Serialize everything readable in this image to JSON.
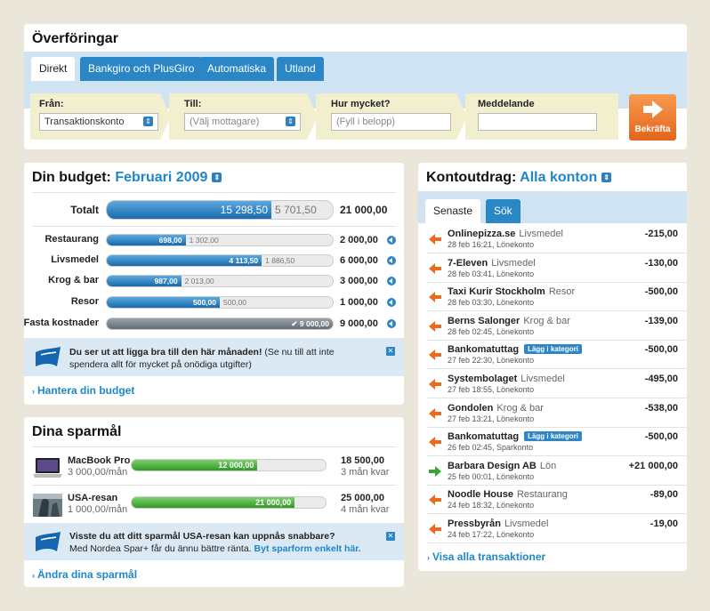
{
  "transfers": {
    "title": "Överföringar",
    "tabs": [
      "Direkt",
      "Bankgiro och PlusGiro",
      "Automatiska",
      "Utland"
    ],
    "from": {
      "label": "Från:",
      "value": "Transaktionskonto"
    },
    "to": {
      "label": "Till:",
      "placeholder": "(Välj mottagare)"
    },
    "amount": {
      "label": "Hur mycket?",
      "placeholder": "(Fyll i belopp)"
    },
    "message": {
      "label": "Meddelande",
      "value": ""
    },
    "confirm_label": "Bekräfta",
    "colors": {
      "confirm": "#e9742a",
      "tab": "#2b86c5",
      "field_bg": "#f2efcf"
    }
  },
  "budget": {
    "title": "Din budget:",
    "period": "Februari 2009",
    "total": {
      "label": "Totalt",
      "spent": "15 298,50",
      "remaining": "5 701,50",
      "amount": "21 000,00",
      "fraction": 0.7285
    },
    "rows": [
      {
        "name": "Restaurang",
        "spent": "698,00",
        "remaining": "1 302,00",
        "amount": "2 000,00",
        "fraction": 0.349
      },
      {
        "name": "Livsmedel",
        "spent": "4 113,50",
        "remaining": "1 886,50",
        "amount": "6 000,00",
        "fraction": 0.6856
      },
      {
        "name": "Krog & bar",
        "spent": "987,00",
        "remaining": "2 013,00",
        "amount": "3 000,00",
        "fraction": 0.329
      },
      {
        "name": "Resor",
        "spent": "500,00",
        "remaining": "500,00",
        "amount": "1 000,00",
        "fraction": 0.5
      },
      {
        "name": "Fasta kostnader",
        "spent": "9 000,00",
        "remaining": "",
        "amount": "9 000,00",
        "fraction": 1.0
      }
    ],
    "tip_bold": "Du ser ut att ligga bra till den här månaden!",
    "tip_text": " (Se nu till att inte spendera allt för mycket på onödiga utgifter)",
    "link": "Hantera din budget"
  },
  "savings": {
    "title": "Dina sparmål",
    "goals": [
      {
        "name": "MacBook Pro",
        "per_month": "3 000,00/mån",
        "saved": "12 000,00",
        "target": "18 500,00",
        "left": "3 mån kvar",
        "fraction": 0.6486
      },
      {
        "name": "USA-resan",
        "per_month": "1 000,00/mån",
        "saved": "21 000,00",
        "target": "25 000,00",
        "left": "4 mån kvar",
        "fraction": 0.84
      }
    ],
    "tip_bold": "Visste du att ditt sparmål USA-resan kan uppnås snabbare?",
    "tip_text": "Med Nordea Spar+ får du ännu bättre ränta. ",
    "tip_link": "Byt sparform enkelt här.",
    "link": "Ändra dina sparmål"
  },
  "statement": {
    "title": "Kontoutdrag:",
    "account": "Alla konton",
    "tabs": [
      "Senaste",
      "Sök"
    ],
    "transactions": [
      {
        "name": "Onlinepizza.se",
        "category": "Livsmedel",
        "badge": "",
        "date": "28 feb 16:21, Lönekonto",
        "amount": "-215,00",
        "direction": "out"
      },
      {
        "name": "7-Eleven",
        "category": "Livsmedel",
        "badge": "",
        "date": "28 feb 03:41, Lönekonto",
        "amount": "-130,00",
        "direction": "out"
      },
      {
        "name": "Taxi Kurir Stockholm",
        "category": "Resor",
        "badge": "",
        "date": "28 feb 03:30, Lönekonto",
        "amount": "-500,00",
        "direction": "out"
      },
      {
        "name": "Berns Salonger",
        "category": "Krog & bar",
        "badge": "",
        "date": "28 feb 02:45, Lönekonto",
        "amount": "-139,00",
        "direction": "out"
      },
      {
        "name": "Bankomatuttag",
        "category": "",
        "badge": "Lägg i kategori",
        "date": "27 feb 22:30, Lönekonto",
        "amount": "-500,00",
        "direction": "out"
      },
      {
        "name": "Systembolaget",
        "category": "Livsmedel",
        "badge": "",
        "date": "27 feb 18:55, Lönekonto",
        "amount": "-495,00",
        "direction": "out"
      },
      {
        "name": "Gondolen",
        "category": "Krog & bar",
        "badge": "",
        "date": "27 feb 13:21, Lönekonto",
        "amount": "-538,00",
        "direction": "out"
      },
      {
        "name": "Bankomatuttag",
        "category": "",
        "badge": "Lägg i kategori",
        "date": "26 feb 02:45, Sparkonto",
        "amount": "-500,00",
        "direction": "out"
      },
      {
        "name": "Barbara Design AB",
        "category": "Lön",
        "badge": "",
        "date": "25 feb 00:01, Lönekonto",
        "amount": "+21 000,00",
        "direction": "in"
      },
      {
        "name": "Noodle House",
        "category": "Restaurang",
        "badge": "",
        "date": "24 feb 18:32, Lönekonto",
        "amount": "-89,00",
        "direction": "out"
      },
      {
        "name": "Pressbyrån",
        "category": "Livsmedel",
        "badge": "",
        "date": "24 feb 17:22, Lönekonto",
        "amount": "-19,00",
        "direction": "out"
      }
    ],
    "link": "Visa alla transaktioner",
    "colors": {
      "out_arrow": "#ec6a1f",
      "in_arrow": "#3aa335"
    }
  }
}
